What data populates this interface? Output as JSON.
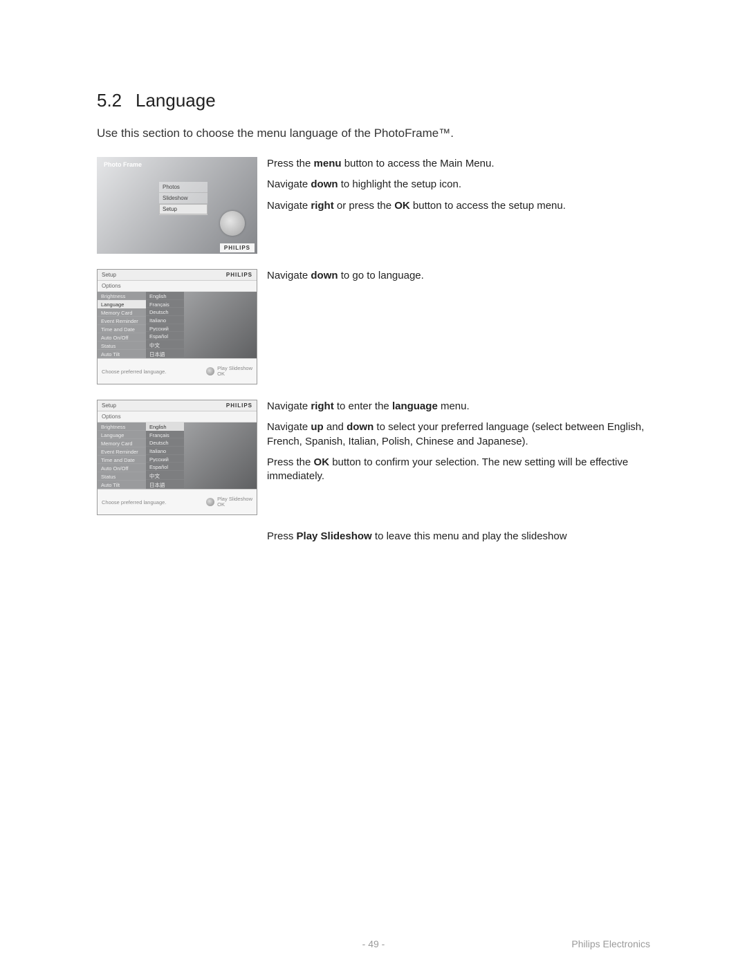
{
  "heading": {
    "number": "5.2",
    "title": "Language"
  },
  "intro": "Use this section to choose the menu language of the PhotoFrame™.",
  "step1": {
    "line1_a": "Press the ",
    "line1_b": "menu",
    "line1_c": " button to access the Main Menu.",
    "line2_a": "Navigate ",
    "line2_b": "down",
    "line2_c": " to highlight the setup icon.",
    "line3_a": "Navigate ",
    "line3_b": "right",
    "line3_c": " or press the ",
    "line3_d": "OK",
    "line3_e": " button to access the setup menu."
  },
  "step2": {
    "line1_a": "Navigate ",
    "line1_b": "down",
    "line1_c": " to go to language."
  },
  "step3": {
    "line1_a": "Navigate ",
    "line1_b": "right",
    "line1_c": " to enter the ",
    "line1_d": "language",
    "line1_e": " menu.",
    "line2_a": "Navigate ",
    "line2_b": "up",
    "line2_c": " and ",
    "line2_d": "down",
    "line2_e": " to select your preferred language (select between English, French, Spanish, Italian, Polish, Chinese and Japanese).",
    "line3_a": "Press the ",
    "line3_b": "OK",
    "line3_c": " button to confirm your selection. The new setting will be effective immediately."
  },
  "closing": {
    "a": "Press ",
    "b": "Play Slideshow",
    "c": " to leave this menu and play the slideshow"
  },
  "footer": {
    "page": "- 49 -",
    "brand": "Philips Electronics"
  },
  "shot1": {
    "title": "Photo Frame",
    "items": [
      "Photos",
      "Slideshow",
      "Setup"
    ],
    "brand": "PHILIPS"
  },
  "shot_setup_common": {
    "top_left": "Setup",
    "brand": "PHILIPS",
    "options": "Options",
    "left_items": [
      "Brightness",
      "Language",
      "Memory Card",
      "Event Reminder",
      "Time and Date",
      "Auto On/Off",
      "Status",
      "Auto Tilt"
    ],
    "langs": [
      "English",
      "Français",
      "Deutsch",
      "Italiano",
      "Русский",
      "Español",
      "中文",
      "日本語"
    ],
    "hint": "Choose preferred language.",
    "btn1": "Play Slideshow",
    "btn2": "OK"
  }
}
